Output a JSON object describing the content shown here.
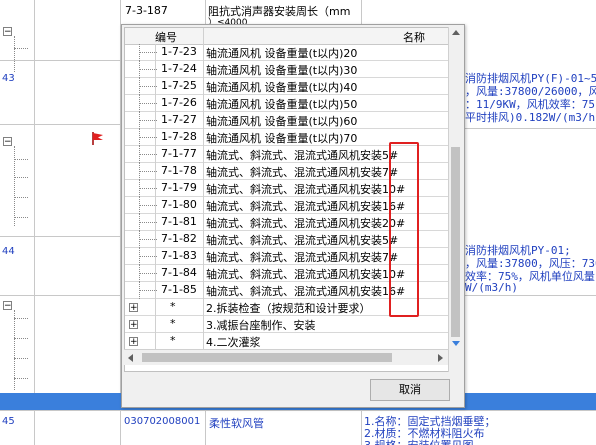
{
  "background": {
    "top_code": "7-3-187",
    "top_name_line1": "阻抗式消声器安装周长（mm",
    "top_name_line2": "）≤4000",
    "row_43_number": "43",
    "row_44_number": "44",
    "row_45_number": "45",
    "row_45_code": "030702008001",
    "row_45_name": "柔性软风管",
    "row_45_desc1": "1.名称：固定式挡烟垂壁；",
    "row_45_desc2": "2.材质：不燃材料阻火布",
    "row_45_desc3": "3.规格：安装位置见图",
    "right_43_lines": [
      "消防排烟风机PY(F)-01~5",
      "，风量:37800/26000，风",
      "：11/9KW，风机效率：75",
      "平时排风)0.182W/(m3/h)"
    ],
    "right_44_lines": [
      "消防排烟风机PY-01;",
      "，风量:37800，风压：736",
      "效率：75%，风机单位风量",
      "W/(m3/h)"
    ],
    "accent_blue": "#3a7fdc",
    "flag_color": "#e02020"
  },
  "dialog": {
    "col_code": "编号",
    "col_name": "名称",
    "rows": [
      {
        "code": "1-7-23",
        "name": "轴流通风机 设备重量(t以内)20"
      },
      {
        "code": "1-7-24",
        "name": "轴流通风机 设备重量(t以内)30"
      },
      {
        "code": "1-7-25",
        "name": "轴流通风机 设备重量(t以内)40"
      },
      {
        "code": "1-7-26",
        "name": "轴流通风机 设备重量(t以内)50"
      },
      {
        "code": "1-7-27",
        "name": "轴流通风机 设备重量(t以内)60"
      },
      {
        "code": "1-7-28",
        "name": "轴流通风机 设备重量(t以内)70"
      },
      {
        "code": "7-1-77",
        "name": "轴流式、斜流式、混流式通风机安装5#"
      },
      {
        "code": "7-1-78",
        "name": "轴流式、斜流式、混流式通风机安装7#"
      },
      {
        "code": "7-1-79",
        "name": "轴流式、斜流式、混流式通风机安装10#"
      },
      {
        "code": "7-1-80",
        "name": "轴流式、斜流式、混流式通风机安装16#"
      },
      {
        "code": "7-1-81",
        "name": "轴流式、斜流式、混流式通风机安装20#"
      },
      {
        "code": "7-1-82",
        "name": "轴流式、斜流式、混流式通风机安装5#"
      },
      {
        "code": "7-1-83",
        "name": "轴流式、斜流式、混流式通风机安装7#"
      },
      {
        "code": "7-1-84",
        "name": "轴流式、斜流式、混流式通风机安装10#"
      },
      {
        "code": "7-1-85",
        "name": "轴流式、斜流式、混流式通风机安装16#"
      }
    ],
    "groups": [
      {
        "star": "*",
        "name": "2.拆装检查（按规范和设计要求）"
      },
      {
        "star": "*",
        "name": "3.减振台座制作、安装"
      },
      {
        "star": "*",
        "name": "4.二次灌浆"
      }
    ],
    "cancel_label": "取消",
    "highlight_color": "#e02020"
  }
}
